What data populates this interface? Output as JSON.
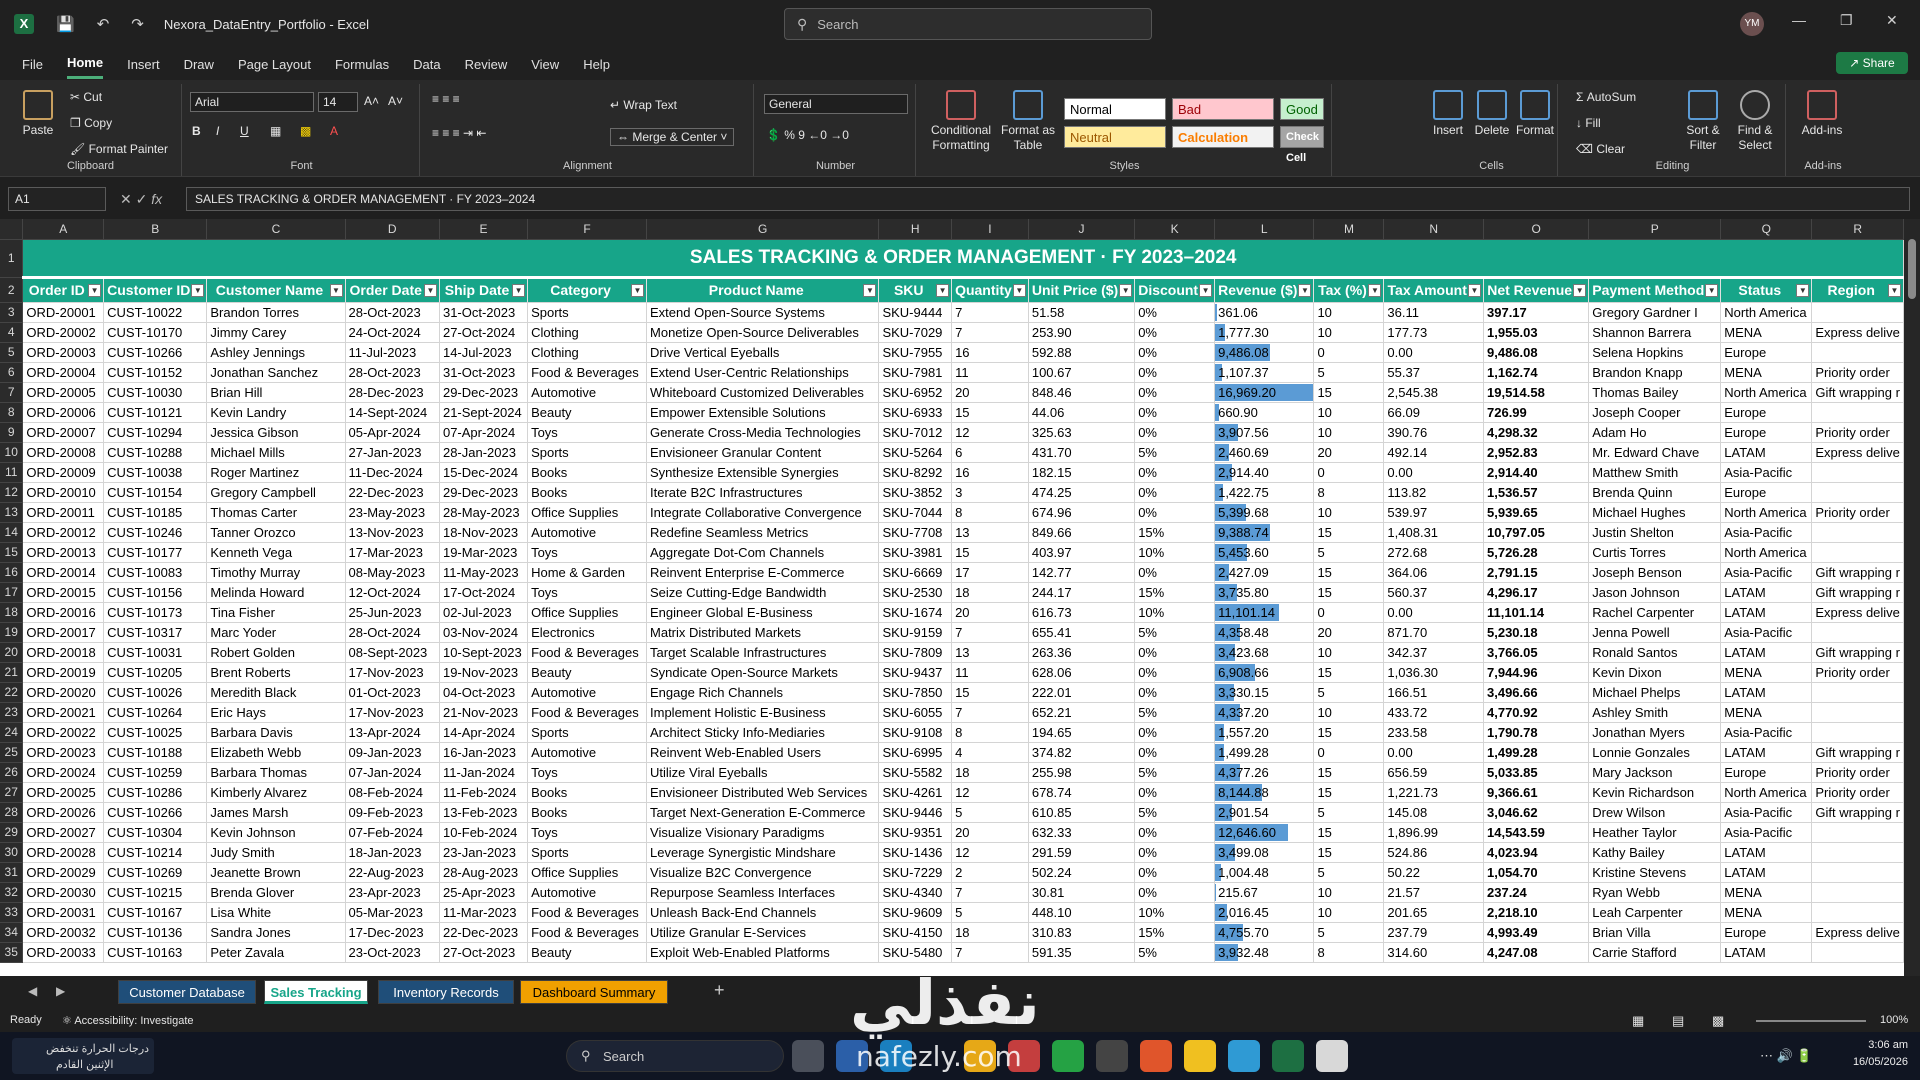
{
  "app": {
    "file_title": "Nexora_DataEntry_Portfolio - Excel",
    "search_placeholder": "Search",
    "avatar_initials": "YM",
    "share_label": "Share",
    "menu": [
      "File",
      "Home",
      "Insert",
      "Draw",
      "Page Layout",
      "Formulas",
      "Data",
      "Review",
      "View",
      "Help"
    ],
    "active_menu": "Home"
  },
  "ribbon": {
    "clipboard": {
      "label": "Clipboard",
      "paste": "Paste",
      "cut": "Cut",
      "copy": "Copy",
      "format_painter": "Format Painter"
    },
    "font": {
      "label": "Font",
      "name": "Arial",
      "size": "14"
    },
    "alignment": {
      "label": "Alignment",
      "wrap_text": "Wrap Text",
      "merge_center": "Merge & Center"
    },
    "number": {
      "label": "Number",
      "format": "General"
    },
    "styles": {
      "label": "Styles",
      "conditional_formatting": "Conditional Formatting",
      "format_as_table": "Format as Table",
      "normal": "Normal",
      "bad": "Bad",
      "good": "Good",
      "neutral": "Neutral",
      "calculation": "Calculation",
      "check_cell": "Check Cell"
    },
    "cells": {
      "label": "Cells",
      "insert": "Insert",
      "delete": "Delete",
      "format": "Format"
    },
    "editing": {
      "label": "Editing",
      "autosum": "AutoSum",
      "fill": "Fill",
      "clear": "Clear",
      "sort_filter": "Sort & Filter",
      "find_select": "Find & Select"
    },
    "addins": {
      "label": "Add-ins",
      "addins": "Add-ins"
    }
  },
  "formula_bar": {
    "name_box": "A1",
    "fx": "fx",
    "content": "SALES TRACKING & ORDER MANAGEMENT · FY 2023–2024"
  },
  "sheet": {
    "columns": [
      "A",
      "B",
      "C",
      "D",
      "E",
      "F",
      "G",
      "H",
      "I",
      "J",
      "K",
      "L",
      "M",
      "N",
      "O",
      "P",
      "Q",
      "R"
    ],
    "title": "SALES TRACKING & ORDER MANAGEMENT · FY 2023–2024",
    "headers": [
      "Order ID",
      "Customer ID",
      "Customer Name",
      "Order Date",
      "Ship Date",
      "Category",
      "Product Name",
      "SKU",
      "Quantity",
      "Unit Price ($)",
      "Discount",
      "Revenue ($)",
      "Tax (%)",
      "Tax Amount",
      "Net Revenue",
      "Payment Method",
      "Status",
      "Region"
    ],
    "rows": [
      [
        "ORD-20001",
        "CUST-10022",
        "Brandon Torres",
        "28-Oct-2023",
        "31-Oct-2023",
        "Sports",
        "Extend Open-Source Systems",
        "SKU-9444",
        "7",
        "51.58",
        "0%",
        "361.06",
        "10",
        "36.11",
        "397.17",
        "Gregory Gardner I",
        "North America",
        ""
      ],
      [
        "ORD-20002",
        "CUST-10170",
        "Jimmy Carey",
        "24-Oct-2024",
        "27-Oct-2024",
        "Clothing",
        "Monetize Open-Source Deliverables",
        "SKU-7029",
        "7",
        "253.90",
        "0%",
        "1,777.30",
        "10",
        "177.73",
        "1,955.03",
        "Shannon Barrera",
        "MENA",
        "Express delive"
      ],
      [
        "ORD-20003",
        "CUST-10266",
        "Ashley Jennings",
        "11-Jul-2023",
        "14-Jul-2023",
        "Clothing",
        "Drive Vertical Eyeballs",
        "SKU-7955",
        "16",
        "592.88",
        "0%",
        "9,486.08",
        "0",
        "0.00",
        "9,486.08",
        "Selena Hopkins",
        "Europe",
        ""
      ],
      [
        "ORD-20004",
        "CUST-10152",
        "Jonathan Sanchez",
        "28-Oct-2023",
        "31-Oct-2023",
        "Food & Beverages",
        "Extend User-Centric Relationships",
        "SKU-7981",
        "11",
        "100.67",
        "0%",
        "1,107.37",
        "5",
        "55.37",
        "1,162.74",
        "Brandon Knapp",
        "MENA",
        "Priority order"
      ],
      [
        "ORD-20005",
        "CUST-10030",
        "Brian Hill",
        "28-Dec-2023",
        "29-Dec-2023",
        "Automotive",
        "Whiteboard Customized Deliverables",
        "SKU-6952",
        "20",
        "848.46",
        "0%",
        "16,969.20",
        "15",
        "2,545.38",
        "19,514.58",
        "Thomas Bailey",
        "North America",
        "Gift wrapping r"
      ],
      [
        "ORD-20006",
        "CUST-10121",
        "Kevin Landry",
        "14-Sept-2024",
        "21-Sept-2024",
        "Beauty",
        "Empower Extensible Solutions",
        "SKU-6933",
        "15",
        "44.06",
        "0%",
        "660.90",
        "10",
        "66.09",
        "726.99",
        "Joseph Cooper",
        "Europe",
        ""
      ],
      [
        "ORD-20007",
        "CUST-10294",
        "Jessica Gibson",
        "05-Apr-2024",
        "07-Apr-2024",
        "Toys",
        "Generate Cross-Media Technologies",
        "SKU-7012",
        "12",
        "325.63",
        "0%",
        "3,907.56",
        "10",
        "390.76",
        "4,298.32",
        "Adam Ho",
        "Europe",
        "Priority order"
      ],
      [
        "ORD-20008",
        "CUST-10288",
        "Michael Mills",
        "27-Jan-2023",
        "28-Jan-2023",
        "Sports",
        "Envisioneer Granular Content",
        "SKU-5264",
        "6",
        "431.70",
        "5%",
        "2,460.69",
        "20",
        "492.14",
        "2,952.83",
        "Mr. Edward Chave",
        "LATAM",
        "Express delive"
      ],
      [
        "ORD-20009",
        "CUST-10038",
        "Roger Martinez",
        "11-Dec-2024",
        "15-Dec-2024",
        "Books",
        "Synthesize Extensible Synergies",
        "SKU-8292",
        "16",
        "182.15",
        "0%",
        "2,914.40",
        "0",
        "0.00",
        "2,914.40",
        "Matthew Smith",
        "Asia-Pacific",
        ""
      ],
      [
        "ORD-20010",
        "CUST-10154",
        "Gregory Campbell",
        "22-Dec-2023",
        "29-Dec-2023",
        "Books",
        "Iterate B2C Infrastructures",
        "SKU-3852",
        "3",
        "474.25",
        "0%",
        "1,422.75",
        "8",
        "113.82",
        "1,536.57",
        "Brenda Quinn",
        "Europe",
        ""
      ],
      [
        "ORD-20011",
        "CUST-10185",
        "Thomas Carter",
        "23-May-2023",
        "28-May-2023",
        "Office Supplies",
        "Integrate Collaborative Convergence",
        "SKU-7044",
        "8",
        "674.96",
        "0%",
        "5,399.68",
        "10",
        "539.97",
        "5,939.65",
        "Michael Hughes",
        "North America",
        "Priority order"
      ],
      [
        "ORD-20012",
        "CUST-10246",
        "Tanner Orozco",
        "13-Nov-2023",
        "18-Nov-2023",
        "Automotive",
        "Redefine Seamless Metrics",
        "SKU-7708",
        "13",
        "849.66",
        "15%",
        "9,388.74",
        "15",
        "1,408.31",
        "10,797.05",
        "Justin Shelton",
        "Asia-Pacific",
        ""
      ],
      [
        "ORD-20013",
        "CUST-10177",
        "Kenneth Vega",
        "17-Mar-2023",
        "19-Mar-2023",
        "Toys",
        "Aggregate Dot-Com Channels",
        "SKU-3981",
        "15",
        "403.97",
        "10%",
        "5,453.60",
        "5",
        "272.68",
        "5,726.28",
        "Curtis Torres",
        "North America",
        ""
      ],
      [
        "ORD-20014",
        "CUST-10083",
        "Timothy Murray",
        "08-May-2023",
        "11-May-2023",
        "Home & Garden",
        "Reinvent Enterprise E-Commerce",
        "SKU-6669",
        "17",
        "142.77",
        "0%",
        "2,427.09",
        "15",
        "364.06",
        "2,791.15",
        "Joseph Benson",
        "Asia-Pacific",
        "Gift wrapping r"
      ],
      [
        "ORD-20015",
        "CUST-10156",
        "Melinda Howard",
        "12-Oct-2024",
        "17-Oct-2024",
        "Toys",
        "Seize Cutting-Edge Bandwidth",
        "SKU-2530",
        "18",
        "244.17",
        "15%",
        "3,735.80",
        "15",
        "560.37",
        "4,296.17",
        "Jason Johnson",
        "LATAM",
        "Gift wrapping r"
      ],
      [
        "ORD-20016",
        "CUST-10173",
        "Tina Fisher",
        "25-Jun-2023",
        "02-Jul-2023",
        "Office Supplies",
        "Engineer Global E-Business",
        "SKU-1674",
        "20",
        "616.73",
        "10%",
        "11,101.14",
        "0",
        "0.00",
        "11,101.14",
        "Rachel Carpenter",
        "LATAM",
        "Express delive"
      ],
      [
        "ORD-20017",
        "CUST-10317",
        "Marc Yoder",
        "28-Oct-2024",
        "03-Nov-2024",
        "Electronics",
        "Matrix Distributed Markets",
        "SKU-9159",
        "7",
        "655.41",
        "5%",
        "4,358.48",
        "20",
        "871.70",
        "5,230.18",
        "Jenna Powell",
        "Asia-Pacific",
        ""
      ],
      [
        "ORD-20018",
        "CUST-10031",
        "Robert Golden",
        "08-Sept-2023",
        "10-Sept-2023",
        "Food & Beverages",
        "Target Scalable Infrastructures",
        "SKU-7809",
        "13",
        "263.36",
        "0%",
        "3,423.68",
        "10",
        "342.37",
        "3,766.05",
        "Ronald Santos",
        "LATAM",
        "Gift wrapping r"
      ],
      [
        "ORD-20019",
        "CUST-10205",
        "Brent Roberts",
        "17-Nov-2023",
        "19-Nov-2023",
        "Beauty",
        "Syndicate Open-Source Markets",
        "SKU-9437",
        "11",
        "628.06",
        "0%",
        "6,908.66",
        "15",
        "1,036.30",
        "7,944.96",
        "Kevin Dixon",
        "MENA",
        "Priority order"
      ],
      [
        "ORD-20020",
        "CUST-10026",
        "Meredith Black",
        "01-Oct-2023",
        "04-Oct-2023",
        "Automotive",
        "Engage Rich Channels",
        "SKU-7850",
        "15",
        "222.01",
        "0%",
        "3,330.15",
        "5",
        "166.51",
        "3,496.66",
        "Michael Phelps",
        "LATAM",
        ""
      ],
      [
        "ORD-20021",
        "CUST-10264",
        "Eric Hays",
        "17-Nov-2023",
        "21-Nov-2023",
        "Food & Beverages",
        "Implement Holistic E-Business",
        "SKU-6055",
        "7",
        "652.21",
        "5%",
        "4,337.20",
        "10",
        "433.72",
        "4,770.92",
        "Ashley Smith",
        "MENA",
        ""
      ],
      [
        "ORD-20022",
        "CUST-10025",
        "Barbara Davis",
        "13-Apr-2024",
        "14-Apr-2024",
        "Sports",
        "Architect Sticky Info-Mediaries",
        "SKU-9108",
        "8",
        "194.65",
        "0%",
        "1,557.20",
        "15",
        "233.58",
        "1,790.78",
        "Jonathan Myers",
        "Asia-Pacific",
        ""
      ],
      [
        "ORD-20023",
        "CUST-10188",
        "Elizabeth Webb",
        "09-Jan-2023",
        "16-Jan-2023",
        "Automotive",
        "Reinvent Web-Enabled Users",
        "SKU-6995",
        "4",
        "374.82",
        "0%",
        "1,499.28",
        "0",
        "0.00",
        "1,499.28",
        "Lonnie Gonzales",
        "LATAM",
        "Gift wrapping r"
      ],
      [
        "ORD-20024",
        "CUST-10259",
        "Barbara Thomas",
        "07-Jan-2024",
        "11-Jan-2024",
        "Toys",
        "Utilize Viral Eyeballs",
        "SKU-5582",
        "18",
        "255.98",
        "5%",
        "4,377.26",
        "15",
        "656.59",
        "5,033.85",
        "Mary Jackson",
        "Europe",
        "Priority order"
      ],
      [
        "ORD-20025",
        "CUST-10286",
        "Kimberly Alvarez",
        "08-Feb-2024",
        "11-Feb-2024",
        "Books",
        "Envisioneer Distributed Web Services",
        "SKU-4261",
        "12",
        "678.74",
        "0%",
        "8,144.88",
        "15",
        "1,221.73",
        "9,366.61",
        "Kevin Richardson",
        "North America",
        "Priority order"
      ],
      [
        "ORD-20026",
        "CUST-10266",
        "James Marsh",
        "09-Feb-2023",
        "13-Feb-2023",
        "Books",
        "Target Next-Generation E-Commerce",
        "SKU-9446",
        "5",
        "610.85",
        "5%",
        "2,901.54",
        "5",
        "145.08",
        "3,046.62",
        "Drew Wilson",
        "Asia-Pacific",
        "Gift wrapping r"
      ],
      [
        "ORD-20027",
        "CUST-10304",
        "Kevin Johnson",
        "07-Feb-2024",
        "10-Feb-2024",
        "Toys",
        "Visualize Visionary Paradigms",
        "SKU-9351",
        "20",
        "632.33",
        "0%",
        "12,646.60",
        "15",
        "1,896.99",
        "14,543.59",
        "Heather Taylor",
        "Asia-Pacific",
        ""
      ],
      [
        "ORD-20028",
        "CUST-10214",
        "Judy Smith",
        "18-Jan-2023",
        "23-Jan-2023",
        "Sports",
        "Leverage Synergistic Mindshare",
        "SKU-1436",
        "12",
        "291.59",
        "0%",
        "3,499.08",
        "15",
        "524.86",
        "4,023.94",
        "Kathy Bailey",
        "LATAM",
        ""
      ],
      [
        "ORD-20029",
        "CUST-10269",
        "Jeanette Brown",
        "22-Aug-2023",
        "28-Aug-2023",
        "Office Supplies",
        "Visualize B2C Convergence",
        "SKU-7229",
        "2",
        "502.24",
        "0%",
        "1,004.48",
        "5",
        "50.22",
        "1,054.70",
        "Kristine Stevens",
        "LATAM",
        ""
      ],
      [
        "ORD-20030",
        "CUST-10215",
        "Brenda Glover",
        "23-Apr-2023",
        "25-Apr-2023",
        "Automotive",
        "Repurpose Seamless Interfaces",
        "SKU-4340",
        "7",
        "30.81",
        "0%",
        "215.67",
        "10",
        "21.57",
        "237.24",
        "Ryan Webb",
        "MENA",
        ""
      ],
      [
        "ORD-20031",
        "CUST-10167",
        "Lisa White",
        "05-Mar-2023",
        "11-Mar-2023",
        "Food & Beverages",
        "Unleash Back-End Channels",
        "SKU-9609",
        "5",
        "448.10",
        "10%",
        "2,016.45",
        "10",
        "201.65",
        "2,218.10",
        "Leah Carpenter",
        "MENA",
        ""
      ],
      [
        "ORD-20032",
        "CUST-10136",
        "Sandra Jones",
        "17-Dec-2023",
        "22-Dec-2023",
        "Food & Beverages",
        "Utilize Granular E-Services",
        "SKU-4150",
        "18",
        "310.83",
        "15%",
        "4,755.70",
        "5",
        "237.79",
        "4,993.49",
        "Brian Villa",
        "Europe",
        "Express delive"
      ],
      [
        "ORD-20033",
        "CUST-10163",
        "Peter Zavala",
        "23-Oct-2023",
        "27-Oct-2023",
        "Beauty",
        "Exploit Web-Enabled Platforms",
        "SKU-5480",
        "7",
        "591.35",
        "5%",
        "3,932.48",
        "8",
        "314.60",
        "4,247.08",
        "Carrie Stafford",
        "LATAM",
        ""
      ]
    ],
    "revenue_max": 16969.2
  },
  "sheet_tabs": [
    {
      "label": "Customer Database",
      "color": "#1f4e79"
    },
    {
      "label": "Sales Tracking",
      "color": "#17a589",
      "active": true
    },
    {
      "label": "Inventory Records",
      "color": "#1f4e79"
    },
    {
      "label": "Dashboard Summary",
      "color": "#f0a000"
    }
  ],
  "status": {
    "ready": "Ready",
    "accessibility": "Accessibility: Investigate",
    "zoom": "100%"
  },
  "taskbar": {
    "weather_line1": "درجات الحرارة تنخفض",
    "weather_line2": "الإثنين القادم",
    "search": "Search",
    "time": "3:06 am",
    "date": "16/05/2026"
  },
  "watermark": {
    "arabic": "نفذلي",
    "latin": "nafezly.com"
  }
}
